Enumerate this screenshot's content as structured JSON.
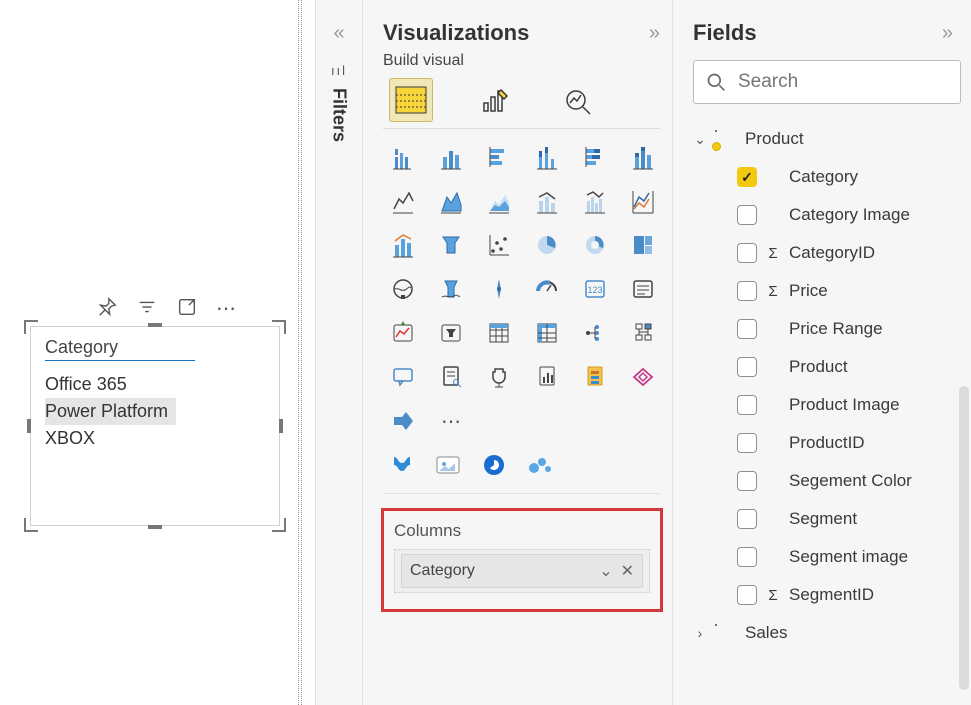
{
  "canvas": {
    "slicer": {
      "title": "Category",
      "items": [
        "Office 365",
        "Power Platform",
        "XBOX"
      ],
      "selected_index": 1
    }
  },
  "filters": {
    "label": "Filters"
  },
  "visualizations": {
    "title": "Visualizations",
    "subtitle": "Build visual",
    "columns_label": "Columns",
    "columns_field": "Category",
    "ellipsis": "⋯"
  },
  "fields": {
    "title": "Fields",
    "search_placeholder": "Search",
    "tables": [
      {
        "name": "Product",
        "expanded": true,
        "has_selection": true,
        "columns": [
          {
            "name": "Category",
            "checked": true,
            "sigma": false
          },
          {
            "name": "Category Image",
            "checked": false,
            "sigma": false
          },
          {
            "name": "CategoryID",
            "checked": false,
            "sigma": true
          },
          {
            "name": "Price",
            "checked": false,
            "sigma": true
          },
          {
            "name": "Price Range",
            "checked": false,
            "sigma": false
          },
          {
            "name": "Product",
            "checked": false,
            "sigma": false
          },
          {
            "name": "Product Image",
            "checked": false,
            "sigma": false
          },
          {
            "name": "ProductID",
            "checked": false,
            "sigma": false
          },
          {
            "name": "Segement Color",
            "checked": false,
            "sigma": false
          },
          {
            "name": "Segment",
            "checked": false,
            "sigma": false
          },
          {
            "name": "Segment image",
            "checked": false,
            "sigma": false
          },
          {
            "name": "SegmentID",
            "checked": false,
            "sigma": true
          }
        ]
      },
      {
        "name": "Sales",
        "expanded": false,
        "has_selection": false,
        "columns": []
      }
    ]
  }
}
